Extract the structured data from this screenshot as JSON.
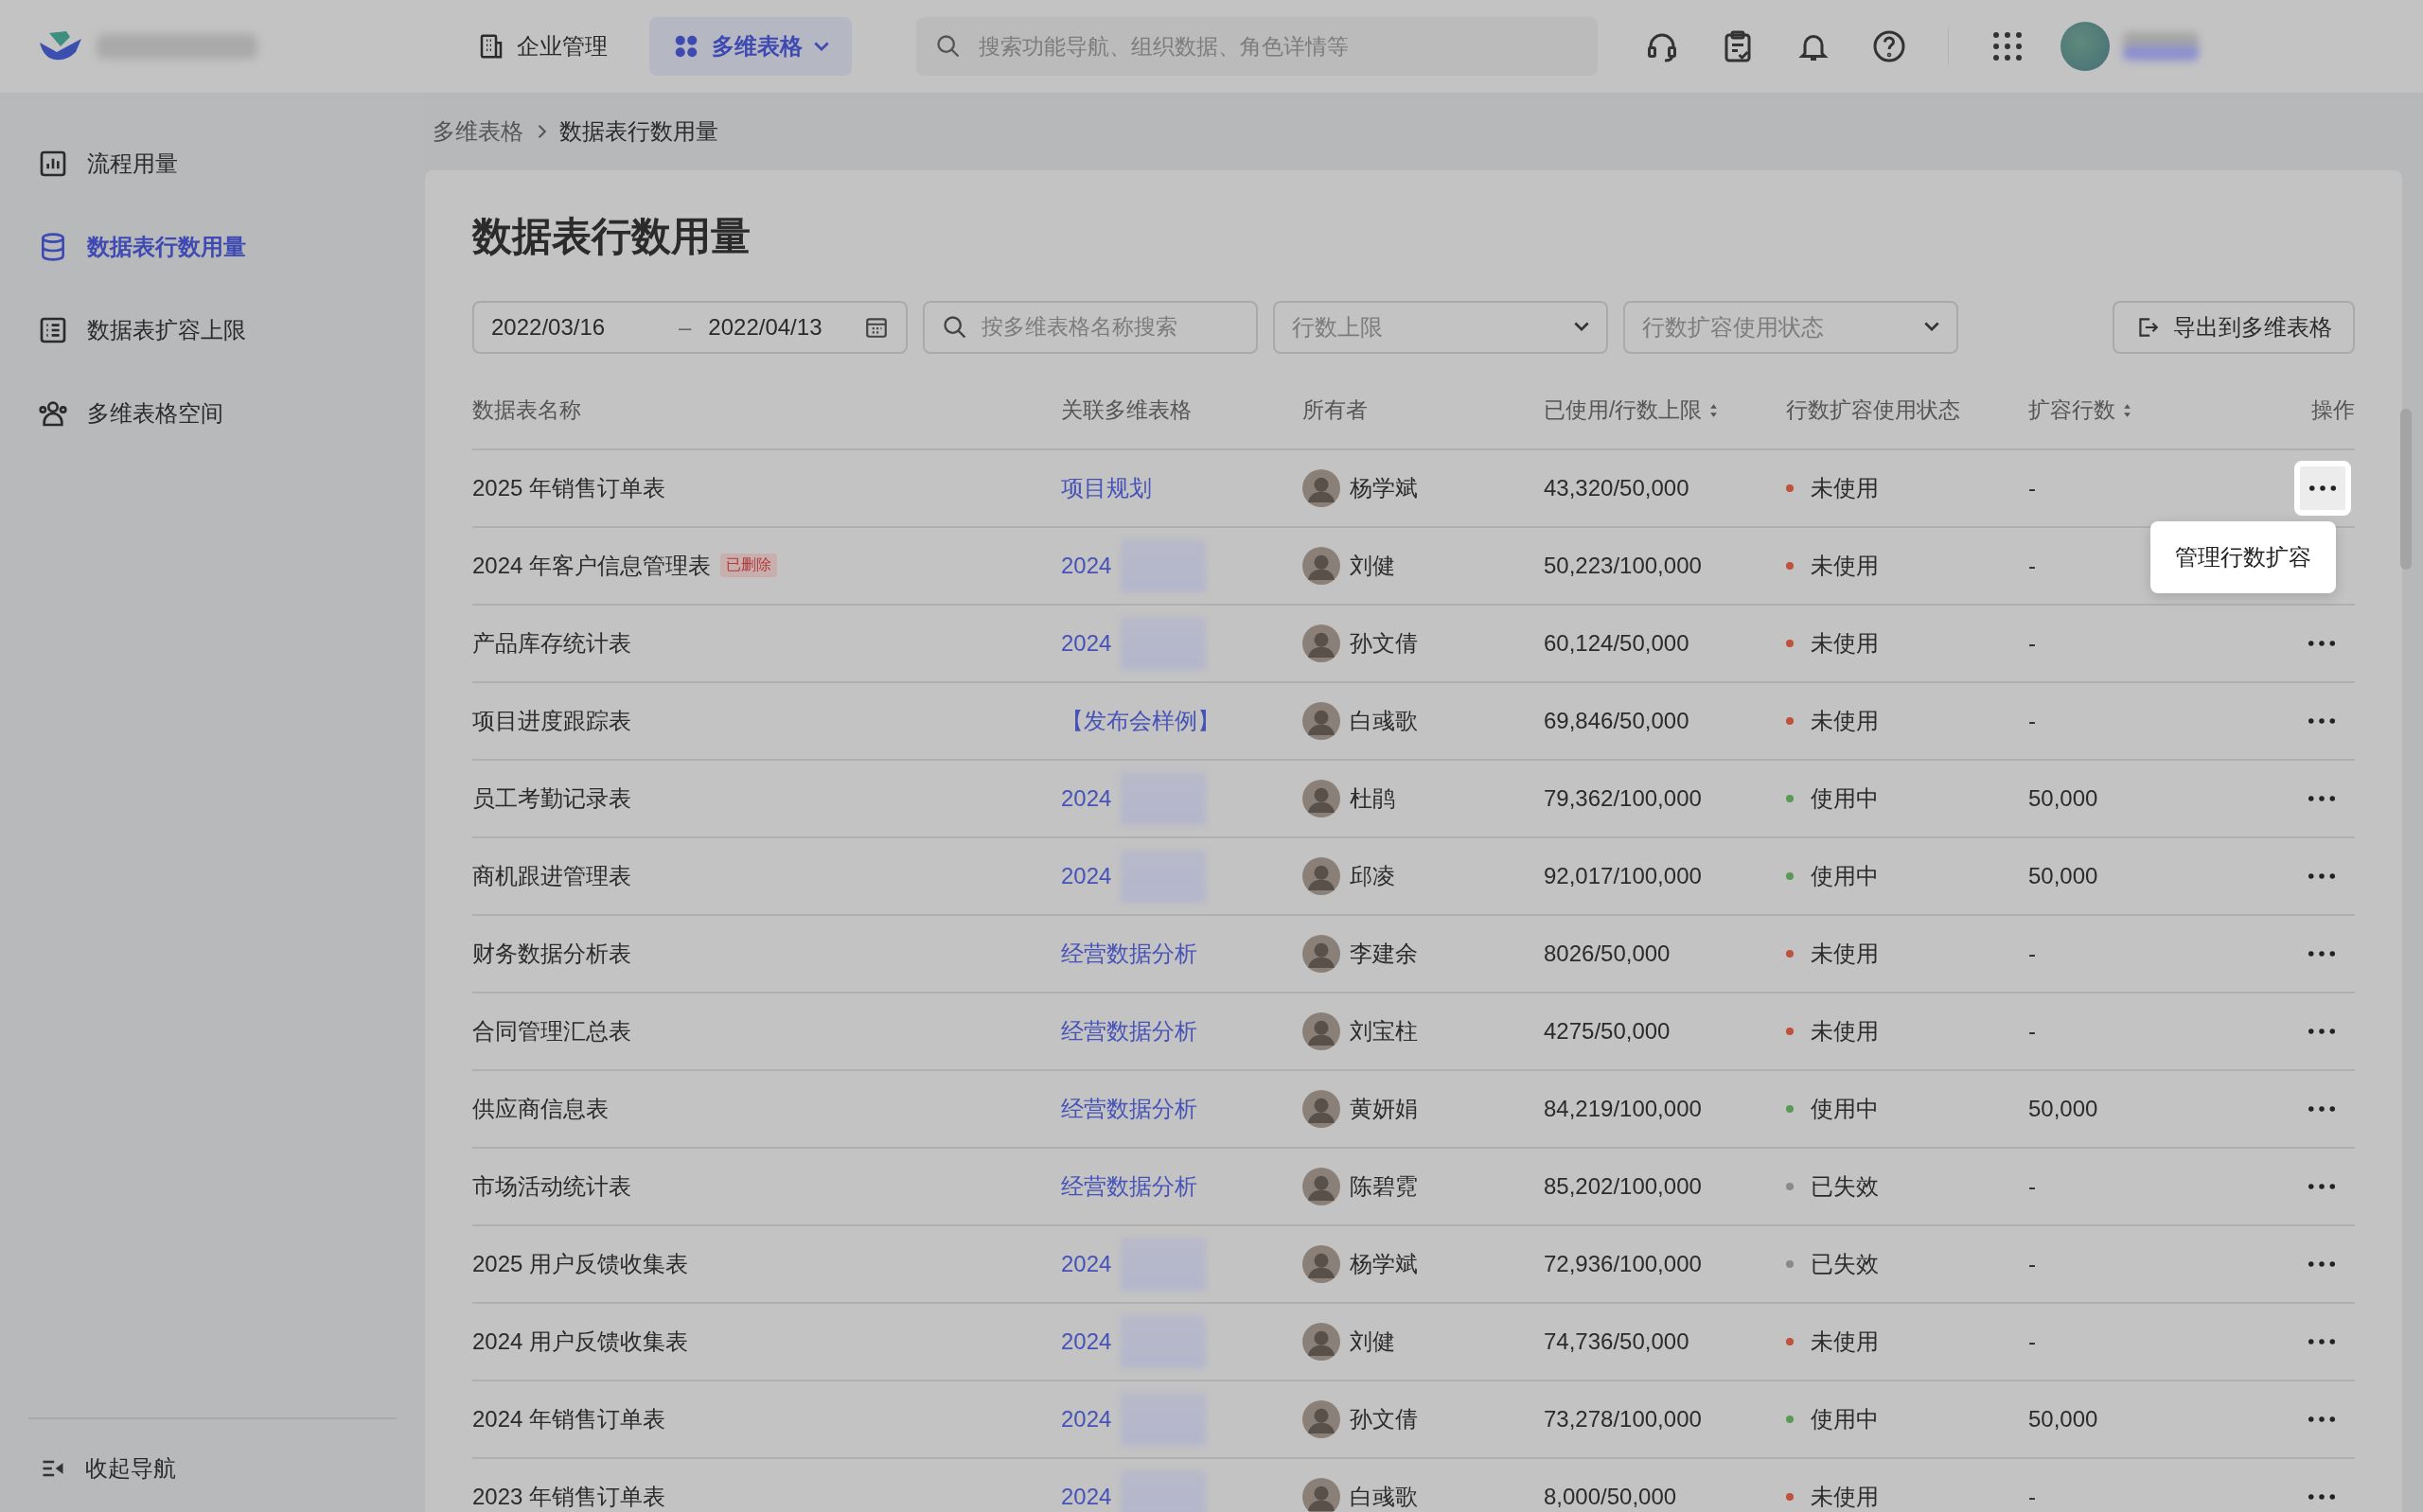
{
  "top_bar": {
    "nav": [
      {
        "label": "企业管理",
        "selected": false
      },
      {
        "label": "多维表格",
        "selected": true
      }
    ],
    "search": {
      "placeholder": "搜索功能导航、组织数据、角色详情等"
    }
  },
  "sidebar": {
    "items": [
      {
        "label": "流程用量",
        "selected": false
      },
      {
        "label": "数据表行数用量",
        "selected": true
      },
      {
        "label": "数据表扩容上限",
        "selected": false
      },
      {
        "label": "多维表格空间",
        "selected": false
      }
    ],
    "collapse": "收起导航"
  },
  "breadcrumb": [
    "多维表格",
    "数据表行数用量"
  ],
  "title": "数据表行数用量",
  "filters": {
    "date_from": "2022/03/16",
    "date_sep": "–",
    "date_to": "2022/04/13",
    "search_placeholder": "按多维表格名称搜索",
    "selects": [
      "行数上限",
      "行数扩容使用状态"
    ],
    "export_button": "导出到多维表格"
  },
  "table": {
    "columns": [
      {
        "label": "数据表名称",
        "sortable": false
      },
      {
        "label": "关联多维表格",
        "sortable": false
      },
      {
        "label": "所有者",
        "sortable": false
      },
      {
        "label": "已使用/行数上限",
        "sortable": true
      },
      {
        "label": "行数扩容使用状态",
        "sortable": false
      },
      {
        "label": "扩容行数",
        "sortable": true
      },
      {
        "label": "操作",
        "sortable": false
      }
    ],
    "rows": [
      {
        "name": "2025 年销售订单表",
        "linked": "项目规划",
        "redacted": false,
        "owner": "杨学斌",
        "used": "43,320/50,000",
        "status": "未使用",
        "color": "#c0513c",
        "expanded": "-",
        "menu_open": true
      },
      {
        "name": "2024 年客户信息管理表",
        "badge": "已删除",
        "linked": "2024",
        "redacted": true,
        "owner": "刘健",
        "used": "50,223/100,000",
        "status": "未使用",
        "color": "#c0513c",
        "expanded": "-",
        "menu_open": false
      },
      {
        "name": "产品库存统计表",
        "linked": "2024",
        "redacted": true,
        "owner": "孙文倩",
        "used": "60,124/50,000",
        "status": "未使用",
        "color": "#c0513c",
        "expanded": "-",
        "menu_open": false
      },
      {
        "name": "项目进度跟踪表",
        "linked": "【发布会样例】",
        "redacted": false,
        "owner": "白彧歌",
        "used": "69,846/50,000",
        "status": "未使用",
        "color": "#c0513c",
        "expanded": "-",
        "menu_open": false
      },
      {
        "name": "员工考勤记录表",
        "linked": "2024",
        "redacted": true,
        "owner": "杜鹃",
        "used": "79,362/100,000",
        "status": "使用中",
        "color": "#5a9a55",
        "expanded": "50,000",
        "menu_open": false
      },
      {
        "name": "商机跟进管理表",
        "linked": "2024",
        "redacted": true,
        "owner": "邱凌",
        "used": "92,017/100,000",
        "status": "使用中",
        "color": "#5a9a55",
        "expanded": "50,000",
        "menu_open": false
      },
      {
        "name": "财务数据分析表",
        "linked": "经营数据分析",
        "redacted": false,
        "owner": "李建余",
        "used": "8026/50,000",
        "status": "未使用",
        "color": "#c0513c",
        "expanded": "-",
        "menu_open": false
      },
      {
        "name": "合同管理汇总表",
        "linked": "经营数据分析",
        "redacted": false,
        "owner": "刘宝柱",
        "used": "4275/50,000",
        "status": "未使用",
        "color": "#c0513c",
        "expanded": "-",
        "menu_open": false
      },
      {
        "name": "供应商信息表",
        "linked": "经营数据分析",
        "redacted": false,
        "owner": "黄妍娟",
        "used": "84,219/100,000",
        "status": "使用中",
        "color": "#5a9a55",
        "expanded": "50,000",
        "menu_open": false
      },
      {
        "name": "市场活动统计表",
        "linked": "经营数据分析",
        "redacted": false,
        "owner": "陈碧霓",
        "used": "85,202/100,000",
        "status": "已失效",
        "color": "#8a8a8a",
        "expanded": "-",
        "menu_open": false
      },
      {
        "name": "2025 用户反馈收集表",
        "linked": "2024",
        "redacted": true,
        "owner": "杨学斌",
        "used": "72,936/100,000",
        "status": "已失效",
        "color": "#8a8a8a",
        "expanded": "-",
        "menu_open": false
      },
      {
        "name": "2024 用户反馈收集表",
        "linked": "2024",
        "redacted": true,
        "owner": "刘健",
        "used": "74,736/50,000",
        "status": "未使用",
        "color": "#c0513c",
        "expanded": "-",
        "menu_open": false
      },
      {
        "name": "2024 年销售订单表",
        "linked": "2024",
        "redacted": true,
        "owner": "孙文倩",
        "used": "73,278/100,000",
        "status": "使用中",
        "color": "#5a9a55",
        "expanded": "50,000",
        "menu_open": false
      },
      {
        "name": "2023 年销售订单表",
        "linked": "2024",
        "redacted": true,
        "owner": "白彧歌",
        "used": "8,000/50,000",
        "status": "未使用",
        "color": "#c0513c",
        "expanded": "-",
        "menu_open": false
      }
    ]
  },
  "action_menu": {
    "items": [
      "管理行数扩容"
    ]
  }
}
